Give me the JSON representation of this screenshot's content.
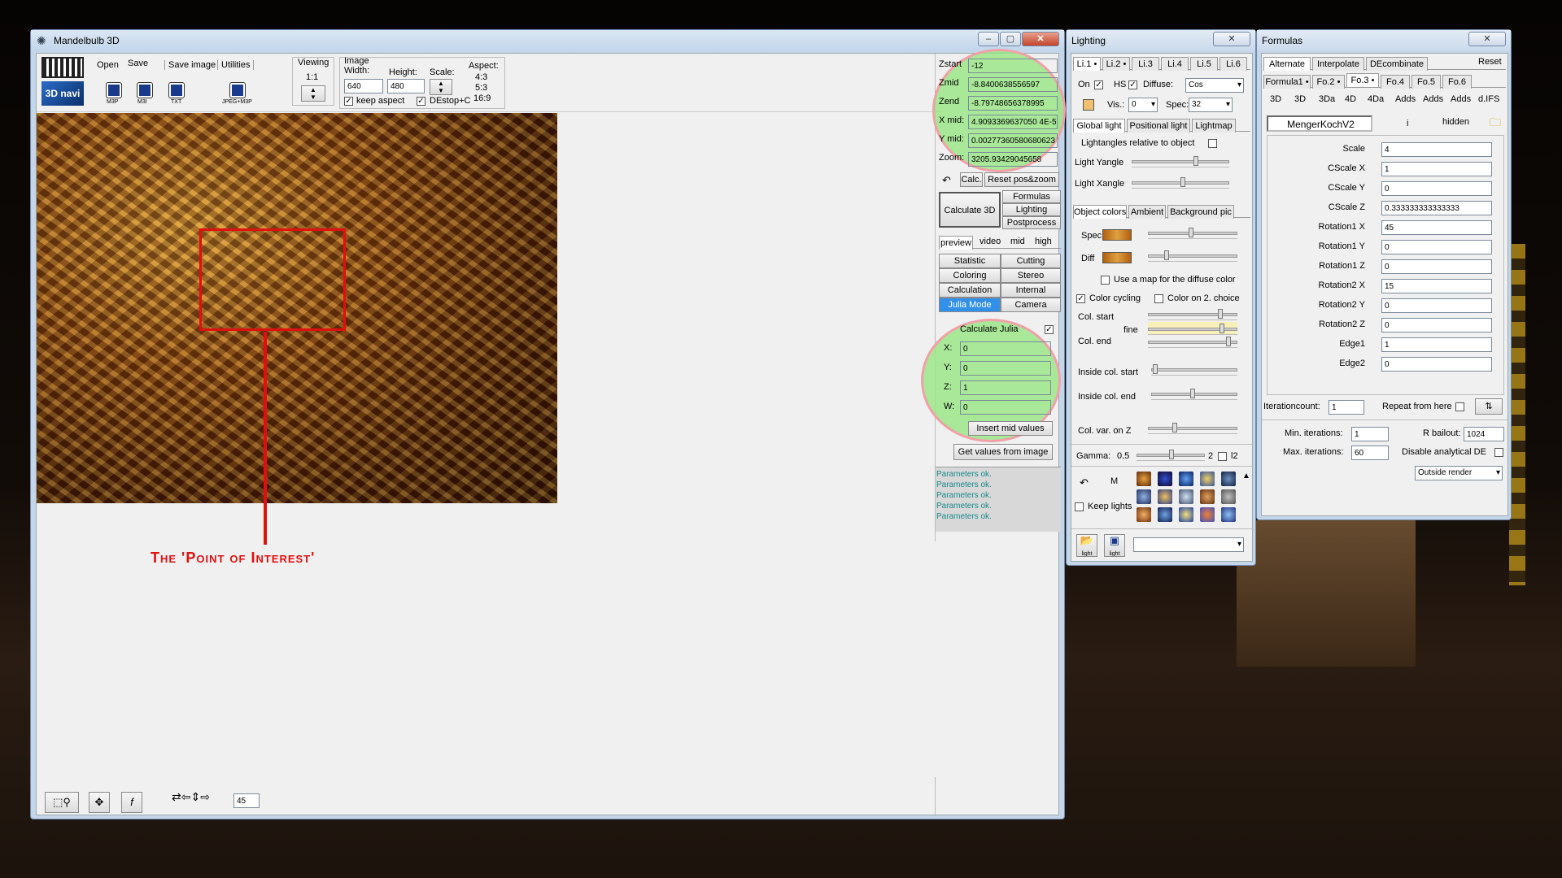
{
  "main": {
    "title": "Mandelbulb 3D",
    "menu": [
      "Open",
      "Save",
      "Save image",
      "Utilities"
    ],
    "nav_button": "3D navi",
    "save_icons": [
      "M3P",
      "M3I",
      "TXT",
      "JPEG+M3P"
    ],
    "viewing": {
      "label": "Viewing",
      "value": "1:1"
    },
    "image": {
      "label": "Image",
      "width_label": "Width:",
      "height_label": "Height:",
      "width": "640",
      "height": "480",
      "scale_label": "Scale:",
      "aspect_label": "Aspect:",
      "aspects": [
        "4:3",
        "5:3",
        "16:9"
      ],
      "keep_aspect": "keep aspect",
      "destop": "DEstop+C"
    },
    "coords": [
      {
        "label": "Zstart",
        "value": "-12"
      },
      {
        "label": "Zmid",
        "value": "-8.8400638556597"
      },
      {
        "label": "Zend",
        "value": "-8.79748656378995"
      },
      {
        "label": "X mid:",
        "value": "4.9093369637050 4E-5"
      },
      {
        "label": "Y mid:",
        "value": "0.00277360580680623"
      },
      {
        "label": "Zoom:",
        "value": "3205.93429045658"
      }
    ],
    "calc_btn": "Calc.",
    "reset_btn": "Reset pos&zoom",
    "calculate3d": "Calculate 3D",
    "side_tabs": [
      "Formulas",
      "Lighting",
      "Postprocess"
    ],
    "quality": [
      "preview",
      "video",
      "mid",
      "high"
    ],
    "panels": [
      [
        "Statistic",
        "Cutting"
      ],
      [
        "Coloring",
        "Stereo"
      ],
      [
        "Calculation",
        "Internal"
      ],
      [
        "Julia Mode",
        "Camera"
      ]
    ],
    "julia": {
      "label": "Calculate Julia",
      "x_label": "X:",
      "y_label": "Y:",
      "z_label": "Z:",
      "w_label": "W:",
      "x": "0",
      "y": "0",
      "z": "1",
      "w": "0",
      "insert": "Insert mid values",
      "get": "Get values from image"
    },
    "log": [
      "Parameters ok.",
      "Parameters ok.",
      "Parameters ok.",
      "Parameters ok.",
      "Parameters ok."
    ],
    "annotation": "The 'Point of Interest'",
    "bottom_value": "45"
  },
  "lighting": {
    "title": "Lighting",
    "light_tabs": [
      "Li.1 •",
      "Li.2 •",
      "Li.3",
      "Li.4",
      "Li.5",
      "Li.6"
    ],
    "on": "On",
    "hs": "HS",
    "diffuse": "Diffuse:",
    "diffuse_val": "Cos",
    "vis": "Vis.:",
    "vis_val": "0",
    "spec": "Spec:",
    "spec_val": "32",
    "tabs2": [
      "Global light",
      "Positional light",
      "Lightmap"
    ],
    "relative": "Lightangles relative to object",
    "yangle": "Light Yangle",
    "xangle": "Light Xangle",
    "tabs3": [
      "Object colors",
      "Ambient",
      "Background pic"
    ],
    "spec_label": "Spec",
    "diff_label": "Diff",
    "usemap": "Use a map for the diffuse color",
    "cycling": "Color cycling",
    "choice2": "Color on 2. choice",
    "colstart": "Col. start",
    "fine": "fine",
    "colend": "Col. end",
    "instart": "Inside col. start",
    "inend": "Inside col. end",
    "colvar": "Col. var. on Z",
    "gamma": "Gamma:",
    "gamma_val": "0.5",
    "two": "2",
    "l2": "l2",
    "keep": "Keep lights",
    "m": "M",
    "light_btn": "light"
  },
  "formulas": {
    "title": "Formulas",
    "top_tabs": [
      "Alternate",
      "Interpolate",
      "DEcombinate"
    ],
    "reset": "Reset",
    "ftabs": [
      "Formula1 •",
      "Fo.2 •",
      "Fo.3 •",
      "Fo.4",
      "Fo.5",
      "Fo.6"
    ],
    "dtabs": [
      "3D",
      "3D",
      "3Da",
      "4D",
      "4Da",
      "Adds",
      "Adds",
      "Adds",
      "d.IFS"
    ],
    "name": "MengerKochV2",
    "info": "i",
    "hidden": "hidden",
    "params": [
      {
        "label": "Scale",
        "value": "4"
      },
      {
        "label": "CScale X",
        "value": "1"
      },
      {
        "label": "CScale Y",
        "value": "0"
      },
      {
        "label": "CScale Z",
        "value": "0.333333333333333"
      },
      {
        "label": "Rotation1 X",
        "value": "45"
      },
      {
        "label": "Rotation1 Y",
        "value": "0"
      },
      {
        "label": "Rotation1 Z",
        "value": "0"
      },
      {
        "label": "Rotation2 X",
        "value": "15"
      },
      {
        "label": "Rotation2 Y",
        "value": "0"
      },
      {
        "label": "Rotation2 Z",
        "value": "0"
      },
      {
        "label": "Edge1",
        "value": "1"
      },
      {
        "label": "Edge2",
        "value": "0"
      }
    ],
    "itercount": "Iterationcount:",
    "itercount_val": "1",
    "repeat": "Repeat from here",
    "min_it": "Min. iterations:",
    "min_val": "1",
    "rbail": "R bailout:",
    "rbail_val": "1024",
    "max_it": "Max. iterations:",
    "max_val": "60",
    "disable": "Disable analytical DE",
    "render": "Outside render"
  }
}
